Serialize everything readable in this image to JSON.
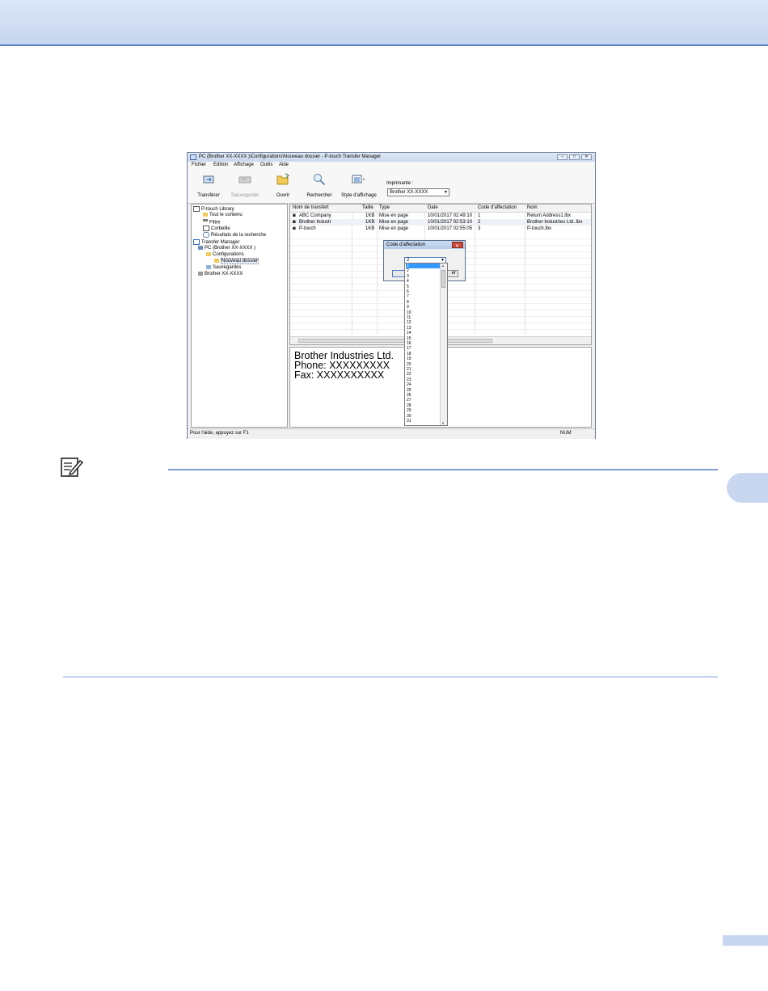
{
  "window": {
    "title": "PC (Brother XX-XXXX )\\Configurations\\Nouveau dossier - P-touch Transfer Manager",
    "controls": [
      "‒",
      "□",
      "✕"
    ]
  },
  "menu": [
    "Fichier",
    "Edition",
    "Affichage",
    "Outils",
    "Aide"
  ],
  "toolbar": {
    "transfer": "Transférer",
    "save": "Sauvegarder",
    "open": "Ouvrir",
    "search": "Rechercher",
    "view_style": "Style d'affichage",
    "printer_label": "Imprimante :",
    "printer_value": "Brother XX-XXXX"
  },
  "tree": {
    "library": "P-touch Library",
    "all_content": "Tout le contenu",
    "filter": "Filtre",
    "trash": "Corbeille",
    "search_results": "Résultats de la recherche",
    "transfer_manager": "Transfer Manager",
    "pc": "PC (Brother XX-XXXX )",
    "configurations": "Configurations",
    "new_folder": "Nouveau dossier",
    "backups": "Sauvegardes",
    "printer": "Brother XX-XXXX"
  },
  "table": {
    "headers": [
      "Nom de transfert",
      "Taille",
      "Type",
      "Date",
      "Code d'affectation",
      "Nom"
    ],
    "rows": [
      [
        "ABC Company",
        "1KB",
        "Mise en page",
        "10/01/2017 02:49:10",
        "1",
        "Return Address1.lbx"
      ],
      [
        "Brother Industr",
        "1KB",
        "Mise en page",
        "10/01/2017 02:53:10",
        "2",
        "Brother Industries Ltd..lbx"
      ],
      [
        "P-touch",
        "1KB",
        "Mise en page",
        "10/01/2017 02:55:05",
        "3",
        "P-touch.lbx"
      ]
    ]
  },
  "preview": {
    "lines": [
      "Brother Industries Ltd.",
      "Phone: XXXXXXXXX",
      "Fax: XXXXXXXXXX"
    ]
  },
  "dialog": {
    "title": "Code d'affectation",
    "selected": "2",
    "button_suffix": "er",
    "options": [
      "1",
      "2",
      "3",
      "4",
      "5",
      "6",
      "7",
      "8",
      "9",
      "10",
      "11",
      "12",
      "13",
      "14",
      "15",
      "16",
      "17",
      "18",
      "19",
      "20",
      "21",
      "22",
      "23",
      "24",
      "25",
      "26",
      "27",
      "28",
      "29",
      "30",
      "31"
    ],
    "highlighted_option": "1"
  },
  "status": {
    "help": "Pour l'aide, appuyez sur F1",
    "num": "NUM"
  },
  "colors": {
    "banner": "#c6d5ef",
    "rule": "#7d9bd6",
    "selection": "#3399ff"
  }
}
